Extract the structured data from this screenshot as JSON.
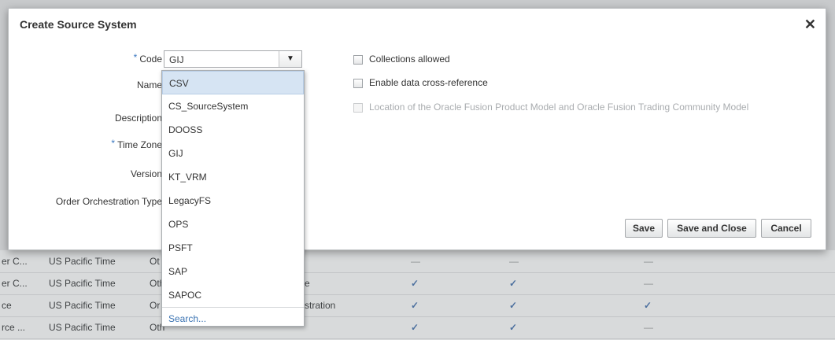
{
  "dialog": {
    "title": "Create Source System",
    "close_glyph": "✕",
    "fields": {
      "code_label": "Code",
      "name_label": "Name",
      "description_label": "Description",
      "time_zone_label": "Time Zone",
      "version_label": "Version",
      "order_type_label": "Order Orchestration Type",
      "required_mark": "*"
    },
    "code_value": "GIJ",
    "checkboxes": [
      {
        "label": "Collections allowed",
        "checked": false,
        "disabled": false
      },
      {
        "label": "Enable data cross-reference",
        "checked": false,
        "disabled": false
      },
      {
        "label": "Location of the Oracle Fusion Product Model and Oracle Fusion Trading Community Model",
        "checked": false,
        "disabled": true
      }
    ],
    "buttons": {
      "save": "Save",
      "save_and_close": "Save and Close",
      "cancel": "Cancel"
    }
  },
  "dropdown": {
    "items": [
      "CSV",
      "CS_SourceSystem",
      "DOOSS",
      "GIJ",
      "KT_VRM",
      "LegacyFS",
      "OPS",
      "PSFT",
      "SAP",
      "SAPOC"
    ],
    "selected_index": 0,
    "search_label": "Search..."
  },
  "background_table": {
    "rows": [
      {
        "name": "er C...",
        "tz": "US Pacific Time",
        "type": "Ot",
        "extra": "",
        "c1": "dash",
        "c2": "dash",
        "c3": "dash"
      },
      {
        "name": "er C...",
        "tz": "US Pacific Time",
        "type": "Oth",
        "extra": "e",
        "c1": "check",
        "c2": "check",
        "c3": "dash"
      },
      {
        "name": "ce",
        "tz": "US Pacific Time",
        "type": "Or",
        "extra": "stration",
        "c1": "check",
        "c2": "check",
        "c3": "check"
      },
      {
        "name": "rce ...",
        "tz": "US Pacific Time",
        "type": "Oth",
        "extra": "",
        "c1": "check",
        "c2": "check",
        "c3": "dash"
      }
    ],
    "check_glyph": "✓",
    "dash_glyph": "—"
  },
  "colors": {
    "accent": "#3c74b3",
    "selected_bg": "#d6e4f3",
    "overlay_bg": "#c8cacc"
  }
}
